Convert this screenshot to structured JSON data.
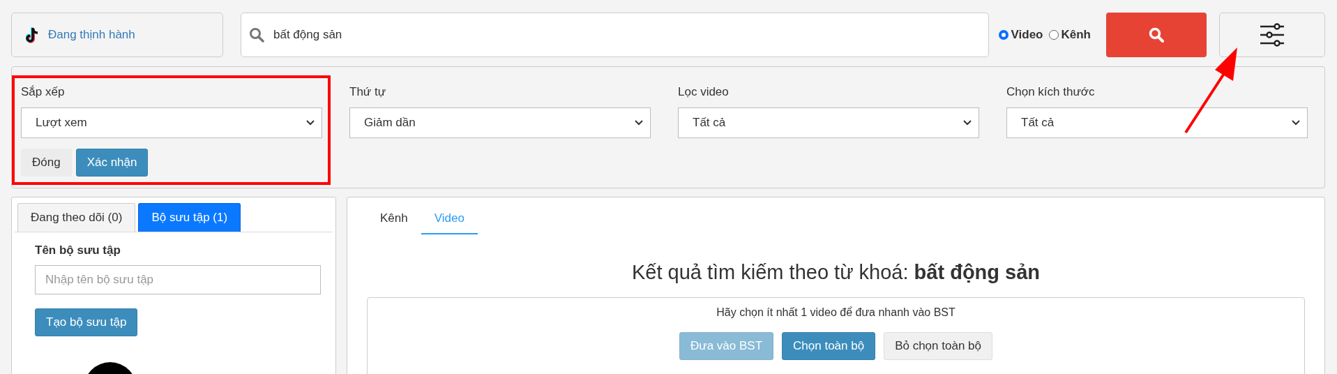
{
  "header": {
    "trending_link": "Đang thịnh hành",
    "search": {
      "value": "bất động sản"
    },
    "search_types": [
      {
        "label": "Video",
        "selected": true
      },
      {
        "label": "Kênh",
        "selected": false
      }
    ]
  },
  "filters": [
    {
      "label": "Sắp xếp",
      "value": "Lượt xem",
      "highlighted": true
    },
    {
      "label": "Thứ tự",
      "value": "Giảm dần",
      "highlighted": false
    },
    {
      "label": "Lọc video",
      "value": "Tất cả",
      "highlighted": false
    },
    {
      "label": "Chọn kích thước",
      "value": "Tất cả",
      "highlighted": false
    }
  ],
  "filter_buttons": [
    {
      "label": "Đóng",
      "kind": "default"
    },
    {
      "label": "Xác nhận",
      "kind": "primary"
    }
  ],
  "sidebar": {
    "tabs": [
      {
        "label": "Đang theo dõi (0)",
        "selected": false
      },
      {
        "label": "Bộ sưu tập (1)",
        "selected": true
      }
    ],
    "collection_name_label": "Tên bộ sưu tập",
    "collection_name_field": {
      "placeholder": "Nhập tên bộ sưu tập"
    },
    "create_button": "Tạo bộ sưu tập"
  },
  "results": {
    "tabs": [
      {
        "label": "Kênh",
        "selected": false
      },
      {
        "label": "Video",
        "selected": true
      }
    ],
    "heading": "Kết quả tìm kiếm theo từ khoá: **bất động sản**",
    "hint": "Hãy chọn ít nhất 1 video để đưa nhanh vào BST",
    "actions": [
      {
        "label": "Đưa vào BST",
        "kind": "primary",
        "disabled": true
      },
      {
        "label": "Chọn toàn bộ",
        "kind": "primary",
        "disabled": false
      },
      {
        "label": "Bỏ chọn toàn bộ",
        "kind": "default",
        "disabled": false
      }
    ]
  }
}
